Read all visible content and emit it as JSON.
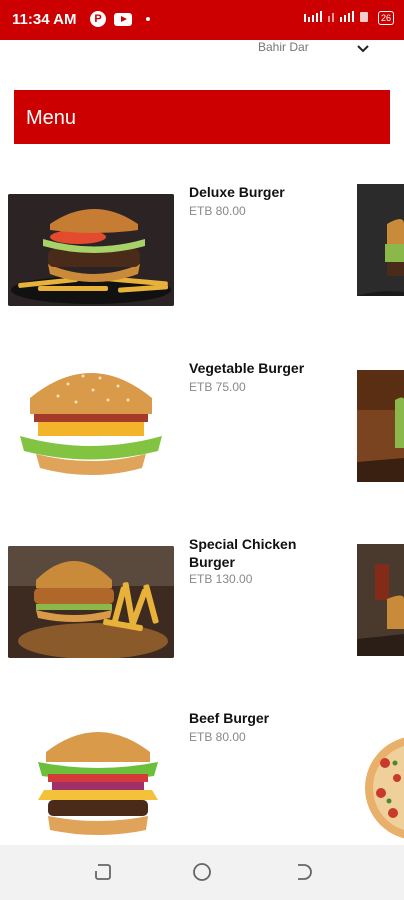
{
  "status_bar": {
    "time": "11:34 AM",
    "p_icon": "P",
    "battery": "26"
  },
  "location": {
    "label": "Bahir Dar"
  },
  "menu": {
    "title": "Menu"
  },
  "items": [
    {
      "name": "Deluxe Burger",
      "price": "ETB 80.00"
    },
    {
      "name": "Vegetable Burger",
      "price": "ETB 75.00"
    },
    {
      "name": "Special Chicken Burger",
      "price": "ETB 130.00"
    },
    {
      "name": "Beef Burger",
      "price": "ETB 80.00"
    }
  ],
  "colors": {
    "brand": "#cc0000",
    "text": "#111111",
    "price": "#888888",
    "nav": "#f2f2f2"
  }
}
